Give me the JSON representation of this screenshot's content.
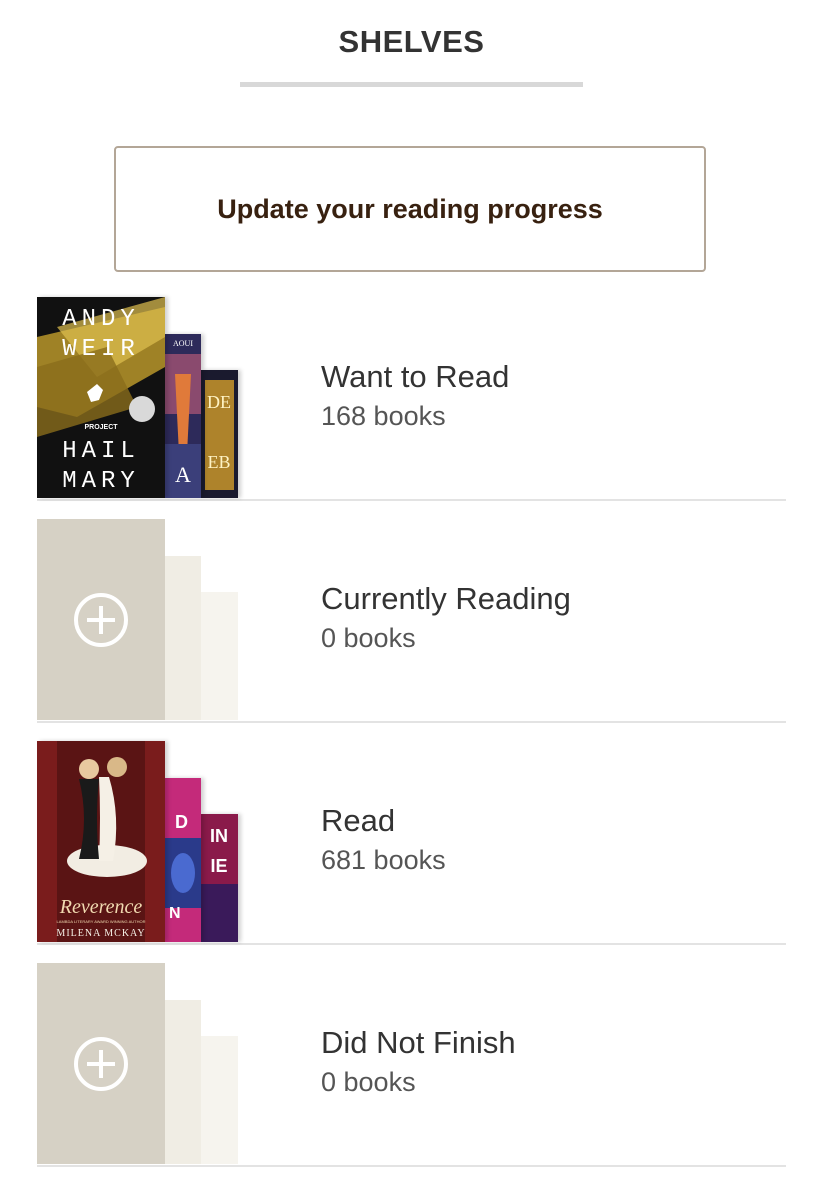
{
  "header": {
    "title": "SHELVES"
  },
  "progress_button": {
    "label": "Update your reading progress"
  },
  "shelves": [
    {
      "name": "Want to Read",
      "count": "168 books",
      "covers": {
        "main": {
          "lines": [
            "ANDY",
            "WEIR",
            "PROJECT",
            "HAIL",
            "MARY"
          ]
        },
        "mid": {
          "text": "AOUI"
        },
        "back": {
          "text": "DE"
        }
      }
    },
    {
      "name": "Currently Reading",
      "count": "0 books"
    },
    {
      "name": "Read",
      "count": "681 books",
      "covers": {
        "main": {
          "title": "Reverence",
          "tagline": "LAMBDA LITERARY AWARD WINNING AUTHOR",
          "author": "MILENA MCKAY"
        },
        "mid": {
          "text": "D"
        },
        "back": {
          "text": "IN"
        }
      }
    },
    {
      "name": "Did Not Finish",
      "count": "0 books"
    }
  ],
  "colors": {
    "accent_text": "#382110",
    "button_border": "#b3a697",
    "placeholder_main": "#d6d1c5",
    "placeholder_mid": "#f0ede4",
    "placeholder_back": "#f6f4ee"
  },
  "icons": {
    "add_shelf": "plus-circle-icon"
  }
}
